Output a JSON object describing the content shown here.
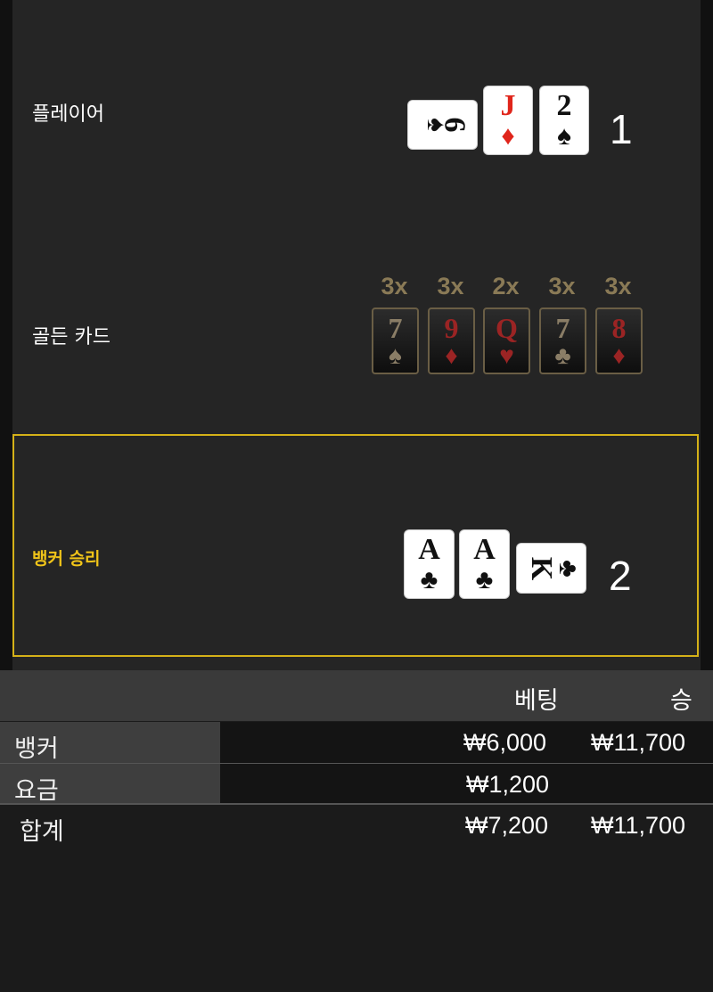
{
  "rows": {
    "player": {
      "label": "플레이어",
      "score": "1",
      "cards": [
        {
          "rank": "6",
          "suit": "♠",
          "color": "black",
          "orientation": "sideways"
        },
        {
          "rank": "J",
          "suit": "♦",
          "color": "red",
          "orientation": "upright"
        },
        {
          "rank": "2",
          "suit": "♠",
          "color": "black",
          "orientation": "upright"
        }
      ]
    },
    "golden": {
      "label": "골든 카드",
      "cards": [
        {
          "mult": "3x",
          "rank": "7",
          "suit": "♠",
          "color": "black"
        },
        {
          "mult": "3x",
          "rank": "9",
          "suit": "♦",
          "color": "red"
        },
        {
          "mult": "2x",
          "rank": "Q",
          "suit": "♥",
          "color": "red"
        },
        {
          "mult": "3x",
          "rank": "7",
          "suit": "♣",
          "color": "black"
        },
        {
          "mult": "3x",
          "rank": "8",
          "suit": "♦",
          "color": "red"
        }
      ]
    },
    "banker": {
      "label": "뱅커 승리",
      "score": "2",
      "cards": [
        {
          "rank": "A",
          "suit": "♣",
          "color": "black",
          "orientation": "upright"
        },
        {
          "rank": "A",
          "suit": "♣",
          "color": "black",
          "orientation": "upright"
        },
        {
          "rank": "K",
          "suit": "♣",
          "color": "black",
          "orientation": "sideways"
        }
      ]
    }
  },
  "table": {
    "headers": {
      "bet": "베팅",
      "win": "승"
    },
    "rows": [
      {
        "label": "뱅커",
        "bet": "₩6,000",
        "win": "₩11,700"
      },
      {
        "label": "요금",
        "bet": "₩1,200",
        "win": ""
      },
      {
        "label": "합계",
        "bet": "₩7,200",
        "win": "₩11,700"
      }
    ]
  },
  "colors": {
    "winner_highlight": "#d4b118",
    "red_suit": "#e0251b",
    "gold_text": "#f0c419"
  }
}
